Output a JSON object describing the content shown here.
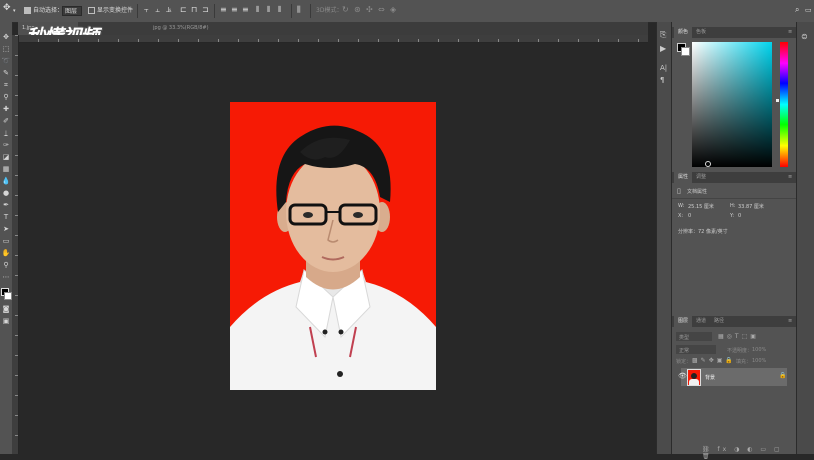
{
  "optionbar": {
    "auto_select_label": "自动选择：",
    "auto_select_value": "图层",
    "show_transform_label": "显示变换控件",
    "mode_3d_label": "3D模式："
  },
  "tabs": [
    {
      "label": "1.jpg"
    },
    {
      "label": "jpg @ 33.3%(RGB/8#)"
    }
  ],
  "watermark": "秒懂视频",
  "color_panel": {
    "tabs": [
      "颜色",
      "色板"
    ],
    "colors": {
      "hue_marker": "#00d4ee",
      "background": "#535353",
      "photo_bg": "#f61a05"
    }
  },
  "properties_panel": {
    "tabs": [
      "属性",
      "调整"
    ],
    "heading": "文档属性",
    "w_label": "W:",
    "w_value": "25.15 厘米",
    "h_label": "H:",
    "h_value": "33.87 厘米",
    "x_label": "X:",
    "x_value": "0",
    "y_label": "Y:",
    "y_value": "0",
    "resolution": "分辨率：72 像素/英寸"
  },
  "layers_panel": {
    "tabs": [
      "图层",
      "通道",
      "路径"
    ],
    "kind_label": "类型",
    "blend_mode": "正常",
    "opacity_label": "不透明度：",
    "opacity_value": "100%",
    "lock_label": "锁定：",
    "fill_label": "填充：",
    "fill_value": "100%",
    "layer_name": "背景"
  }
}
